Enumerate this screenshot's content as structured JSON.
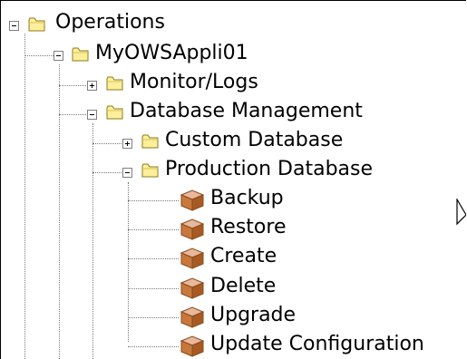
{
  "tree": {
    "root": {
      "label": "Operations",
      "state": "expanded",
      "icon": "folder-icon",
      "children": [
        {
          "label": "MyOWSAppli01",
          "state": "expanded",
          "icon": "folder-icon",
          "children": [
            {
              "label": "Monitor/Logs",
              "state": "collapsed",
              "icon": "folder-icon"
            },
            {
              "label": "Database Management",
              "state": "expanded",
              "icon": "folder-icon",
              "children": [
                {
                  "label": "Custom Database",
                  "state": "collapsed",
                  "icon": "folder-icon"
                },
                {
                  "label": "Production Database",
                  "state": "expanded",
                  "icon": "folder-icon",
                  "children": [
                    {
                      "label": "Backup",
                      "icon": "package-icon"
                    },
                    {
                      "label": "Restore",
                      "icon": "package-icon"
                    },
                    {
                      "label": "Create",
                      "icon": "package-icon"
                    },
                    {
                      "label": "Delete",
                      "icon": "package-icon"
                    },
                    {
                      "label": "Upgrade",
                      "icon": "package-icon"
                    },
                    {
                      "label": "Update Configuration",
                      "icon": "package-icon"
                    }
                  ]
                }
              ]
            }
          ]
        }
      ]
    }
  },
  "colors": {
    "folder_fill": "#ffef9a",
    "folder_stroke": "#8c7a1e",
    "package_top": "#e8b89a",
    "package_body": "#c8783c",
    "tree_line": "#7a7a7a"
  }
}
